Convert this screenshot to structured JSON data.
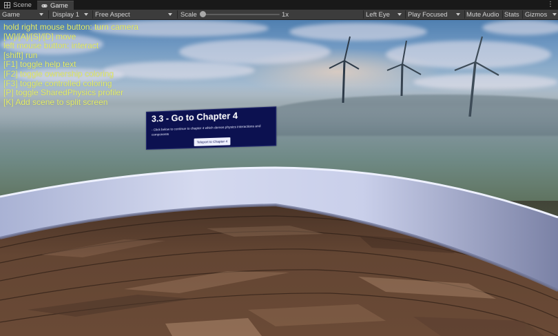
{
  "tabs": [
    {
      "label": "Scene",
      "icon": "grid-icon",
      "active": false
    },
    {
      "label": "Game",
      "icon": "gamepad-icon",
      "active": true
    }
  ],
  "toolbar": {
    "view_mode": "Game",
    "display": "Display 1",
    "aspect": "Free Aspect",
    "scale_label": "Scale",
    "scale_value": "1x",
    "eye": "Left Eye",
    "play_mode": "Play Focused",
    "mute_audio": "Mute Audio",
    "stats": "Stats",
    "gizmos": "Gizmos"
  },
  "help_text": [
    "hold right mouse button: turn camera",
    "[W]/[A]/[S]/[D] move",
    "left mouse button: interact",
    "[shift] run",
    "[F1] toggle help text",
    "[F2] toggle ownership coloring",
    "[F3] toggle controlled coloring",
    "[P] toggle SharedPhysics profiler",
    "[K] Add scene to split screen"
  ],
  "panel": {
    "title": "3.3 - Go to Chapter 4",
    "description": "- Click below to continue to chapter 4 which demos physics interactions and components",
    "button_label": "Teleport to Chapter 4"
  },
  "colors": {
    "help_text": "#e6ef6a",
    "panel_bg": "#0c1150",
    "toolbar_bg": "#3c3c3c"
  }
}
